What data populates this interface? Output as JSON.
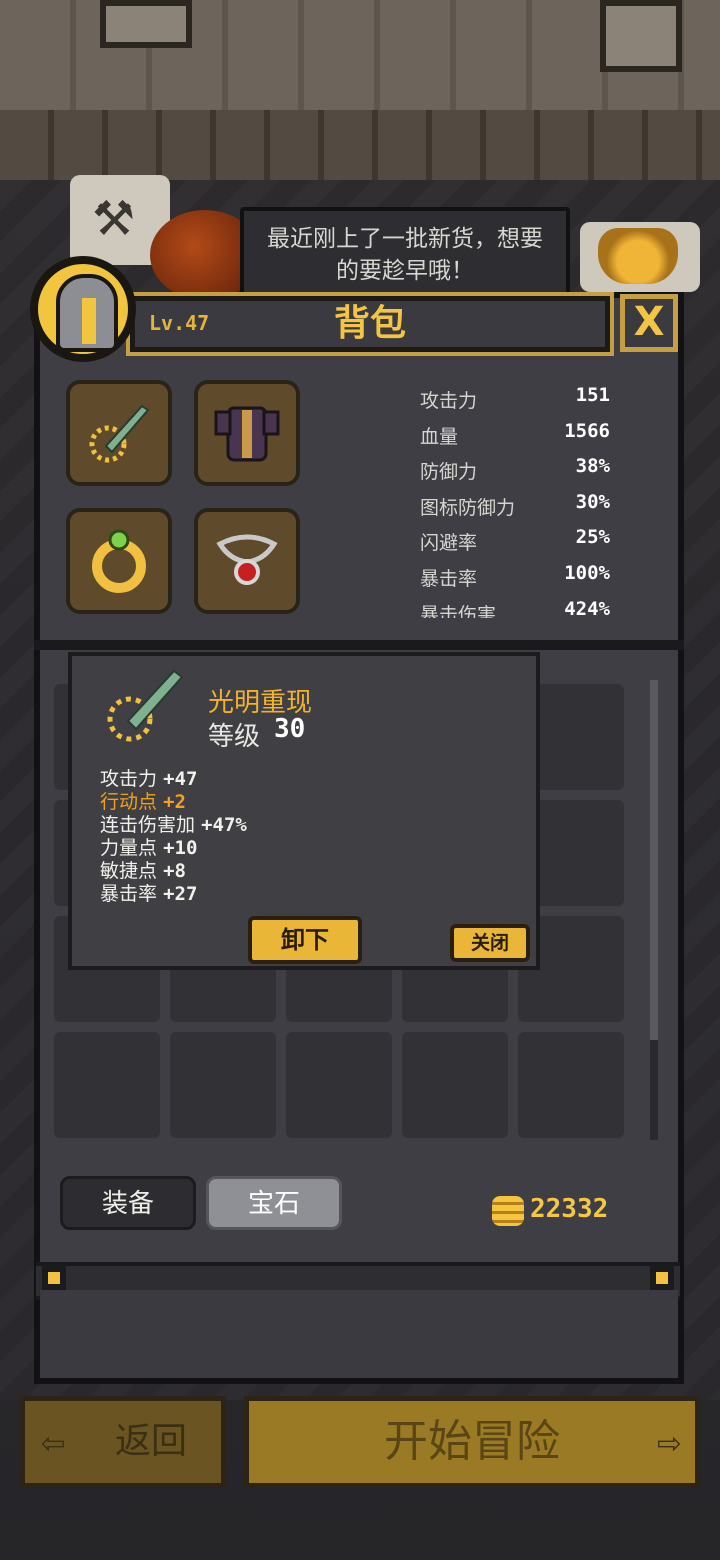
{
  "dialog": {
    "speech_line1": "最近刚上了一批新货，想要",
    "speech_line2": "的要趁早哦！"
  },
  "header": {
    "level": "Lv.47",
    "title": "背包",
    "close_glyph": "X"
  },
  "stats": [
    {
      "label": "攻击力",
      "value": "151"
    },
    {
      "label": "血量",
      "value": "1566"
    },
    {
      "label": "防御力",
      "value": "38%"
    },
    {
      "label": "图标防御力",
      "value": "30%"
    },
    {
      "label": "闪避率",
      "value": "25%"
    },
    {
      "label": "暴击率",
      "value": "100%"
    },
    {
      "label": "暴击伤害",
      "value": "424%"
    }
  ],
  "item_popup": {
    "name": "光明重现",
    "level_label": "等级",
    "level_value": "30",
    "attributes": [
      {
        "label": "攻击力",
        "value": "+47",
        "highlight": false
      },
      {
        "label": "行动点",
        "value": "+2",
        "highlight": true
      },
      {
        "label": "连击伤害加",
        "value": "+47%",
        "highlight": false
      },
      {
        "label": "力量点",
        "value": "+10",
        "highlight": false
      },
      {
        "label": "敏捷点",
        "value": " +8",
        "highlight": false
      },
      {
        "label": "暴击率",
        "value": "+27",
        "highlight": false
      }
    ],
    "unequip_label": "卸下",
    "close_label": "关闭"
  },
  "tabs": {
    "equipment": "装备",
    "gems": "宝石"
  },
  "gold": "22332",
  "footer": {
    "back_label": "返回",
    "start_label": "开始冒险"
  },
  "icons": {
    "weapon_slot": "sword-icon",
    "armor_slot": "armor-icon",
    "ring_slot": "ring-icon",
    "amulet_slot": "amulet-icon"
  },
  "colors": {
    "accent_gold": "#f3c545",
    "highlight_orange": "#f2a01e",
    "panel_bg": "#3e3e44"
  }
}
